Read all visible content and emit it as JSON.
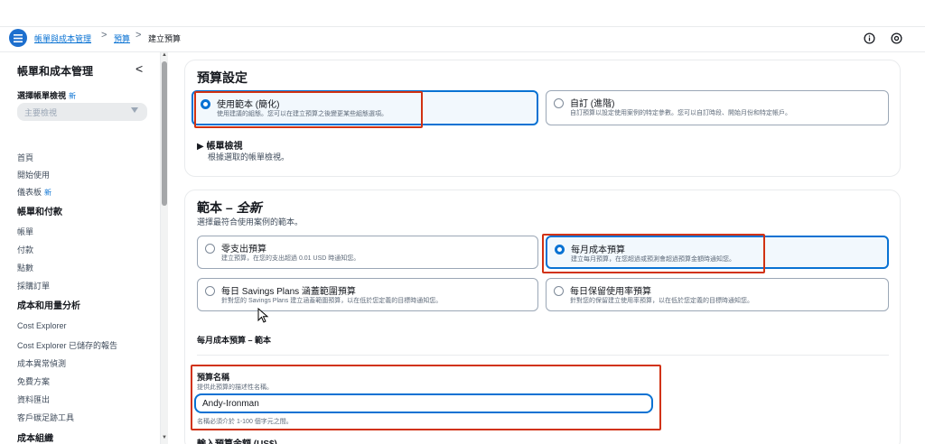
{
  "breadcrumb": {
    "item1": "帳單與成本管理",
    "sep1": ">",
    "item2": "預算",
    "sep2": ">",
    "current": "建立預算"
  },
  "header": {
    "info_icon": "info-icon",
    "help_icon": "help-circle-icon",
    "menu_icon": "hamburger-menu-icon"
  },
  "sidebar": {
    "title": "帳單和成本管理",
    "collapse": "<",
    "view_label": "選擇帳單檢視",
    "view_new": "新",
    "view_select_placeholder": "主要檢視",
    "items_top": [
      "首頁",
      "開始使用"
    ],
    "dashboard_label": "儀表板",
    "dashboard_new": "新",
    "section1": "帳單和付款",
    "section1_items": [
      "帳單",
      "付款",
      "點數",
      "採購訂單"
    ],
    "section2": "成本和用量分析",
    "section2_items": [
      "Cost Explorer",
      "Cost Explorer 已儲存的報告",
      "成本異常偵測",
      "免費方案",
      "資料匯出",
      "客戶碳足跡工具"
    ],
    "section3": "成本組織"
  },
  "budget_setup": {
    "title": "預算設定",
    "option_template": {
      "label": "使用範本 (簡化)",
      "desc": "使用建議的組態。您可以在建立預算之後變更某些組態選項。",
      "selected": true
    },
    "option_custom": {
      "label": "自訂 (進階)",
      "desc": "自訂預算以設定使用案例的特定參數。您可以自訂時段、開始月份和特定帳戶。",
      "selected": false
    },
    "billing_view_expander": "▶ 帳單檢視",
    "billing_view_desc": "根據選取的帳單檢視。"
  },
  "templates": {
    "title_prefix": "範本 – ",
    "title_new": "全新",
    "subtitle": "選擇最符合使用案例的範本。",
    "options": [
      {
        "label": "零支出預算",
        "desc": "建立預算，在您的支出超過 0.01 USD 時通知您。",
        "selected": false
      },
      {
        "label": "每月成本預算",
        "desc": "建立每月預算，在您超過或預測會超過預算金額時通知您。",
        "selected": true
      },
      {
        "label": "每日 Savings Plans 涵蓋範圍預算",
        "desc": "針對您的 Savings Plans 建立涵蓋範圍預算，以在低於您定義的目標時通知您。",
        "selected": false
      },
      {
        "label": "每日保留使用率預算",
        "desc": "針對您的保留建立使用率預算，以在低於您定義的目標時通知您。",
        "selected": false
      }
    ],
    "section_heading": "每月成本預算 – 範本",
    "name_label": "預算名稱",
    "name_desc": "提供此預算的描述性名稱。",
    "name_value": "Andy-Ironman",
    "name_constraint": "名稱必須介於 1-100 個字元之間。",
    "amount_label": "輸入預算金額 (US$)"
  },
  "colors": {
    "accent": "#0972d3",
    "highlight": "#d13212"
  }
}
